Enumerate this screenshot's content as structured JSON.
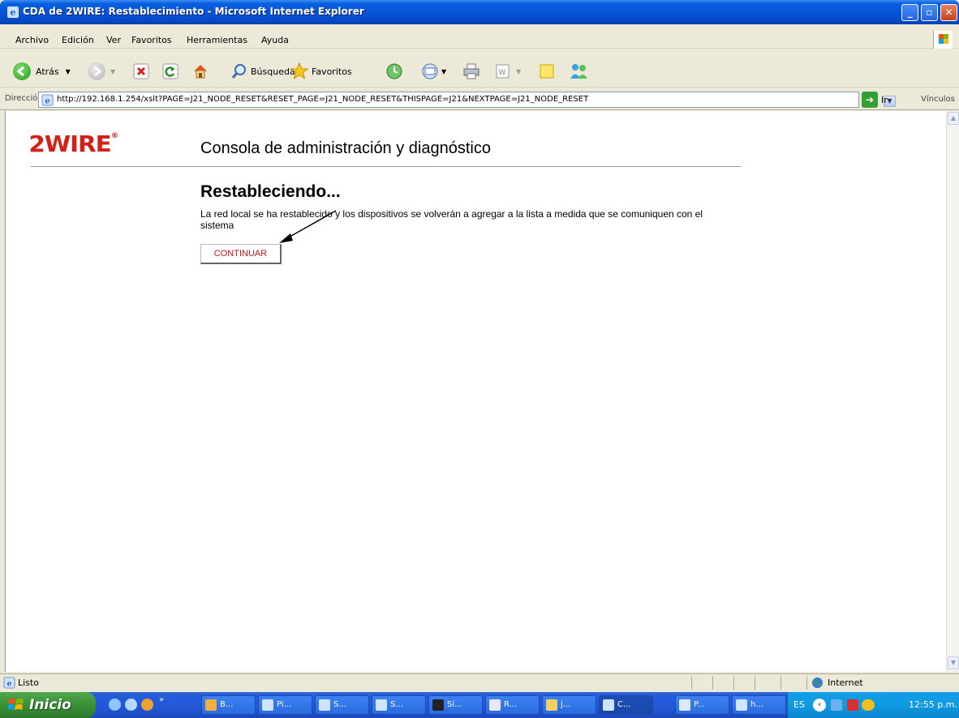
{
  "window": {
    "title": "CDA de 2WIRE: Restablecimiento - Microsoft Internet Explorer",
    "min_glyph": "_",
    "max_glyph": "▫",
    "close_glyph": "✕"
  },
  "menu": {
    "items": [
      "Archivo",
      "Edición",
      "Ver",
      "Favoritos",
      "Herramientas",
      "Ayuda"
    ]
  },
  "toolbar": {
    "back_label": "Atrás",
    "search_label": "Búsqueda",
    "favorites_label": "Favoritos"
  },
  "address": {
    "label": "Dirección",
    "url": "http://192.168.1.254/xslt?PAGE=J21_NODE_RESET&RESET_PAGE=J21_NODE_RESET&THISPAGE=J21&NEXTPAGE=J21_NODE_RESET",
    "go_label": "Ir",
    "links_label": "Vínculos"
  },
  "page": {
    "logo_text": "2WIRE",
    "logo_reg": "®",
    "console_title": "Consola de administración y diagnóstico",
    "heading": "Restableciendo...",
    "message": "La red local se ha restablecido y los dispositivos se volverán a agregar a la lista a medida que se comuniquen con el sistema",
    "continue_label": "CONTINUAR"
  },
  "status": {
    "text": "Listo",
    "zone": "Internet"
  },
  "taskbar": {
    "start_label": "Inicio",
    "buttons": [
      "B...",
      "Pi...",
      "S...",
      "S...",
      "Sí...",
      "R...",
      "j...",
      "C...",
      "P...",
      "h..."
    ],
    "lang": "ES",
    "clock": "12:55 p.m."
  },
  "colors": {
    "brand_red": "#d12118",
    "xp_blue": "#0553d7"
  }
}
